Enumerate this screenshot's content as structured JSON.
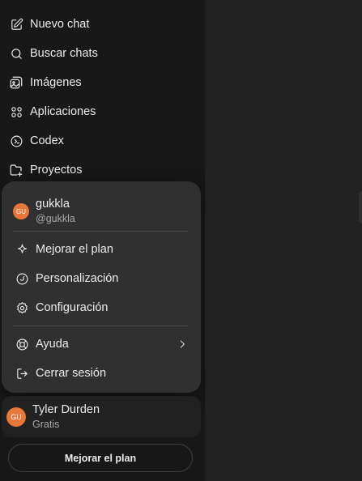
{
  "sidebar": {
    "nav": [
      {
        "label": "Nuevo chat",
        "icon": "edit-icon"
      },
      {
        "label": "Buscar chats",
        "icon": "search-icon"
      },
      {
        "label": "Imágenes",
        "icon": "images-icon"
      },
      {
        "label": "Aplicaciones",
        "icon": "apps-icon"
      },
      {
        "label": "Codex",
        "icon": "codex-icon"
      },
      {
        "label": "Proyectos",
        "icon": "folder-plus-icon"
      }
    ]
  },
  "popover": {
    "user": {
      "initials": "GU",
      "name": "gukkla",
      "handle": "@gukkla"
    },
    "group1": [
      {
        "label": "Mejorar el plan",
        "icon": "sparkle-icon"
      },
      {
        "label": "Personalización",
        "icon": "personalize-icon"
      },
      {
        "label": "Configuración",
        "icon": "gear-icon"
      }
    ],
    "group2": [
      {
        "label": "Ayuda",
        "icon": "lifebuoy-icon",
        "submenu": true
      },
      {
        "label": "Cerrar sesión",
        "icon": "logout-icon"
      }
    ]
  },
  "account": {
    "initials": "GU",
    "name": "Tyler Durden",
    "plan": "Gratis"
  },
  "upgrade_button": "Mejorar el plan",
  "colors": {
    "sidebar_bg": "#181818",
    "main_bg": "#212121",
    "popover_bg": "#303030",
    "avatar": "#e8773a"
  }
}
